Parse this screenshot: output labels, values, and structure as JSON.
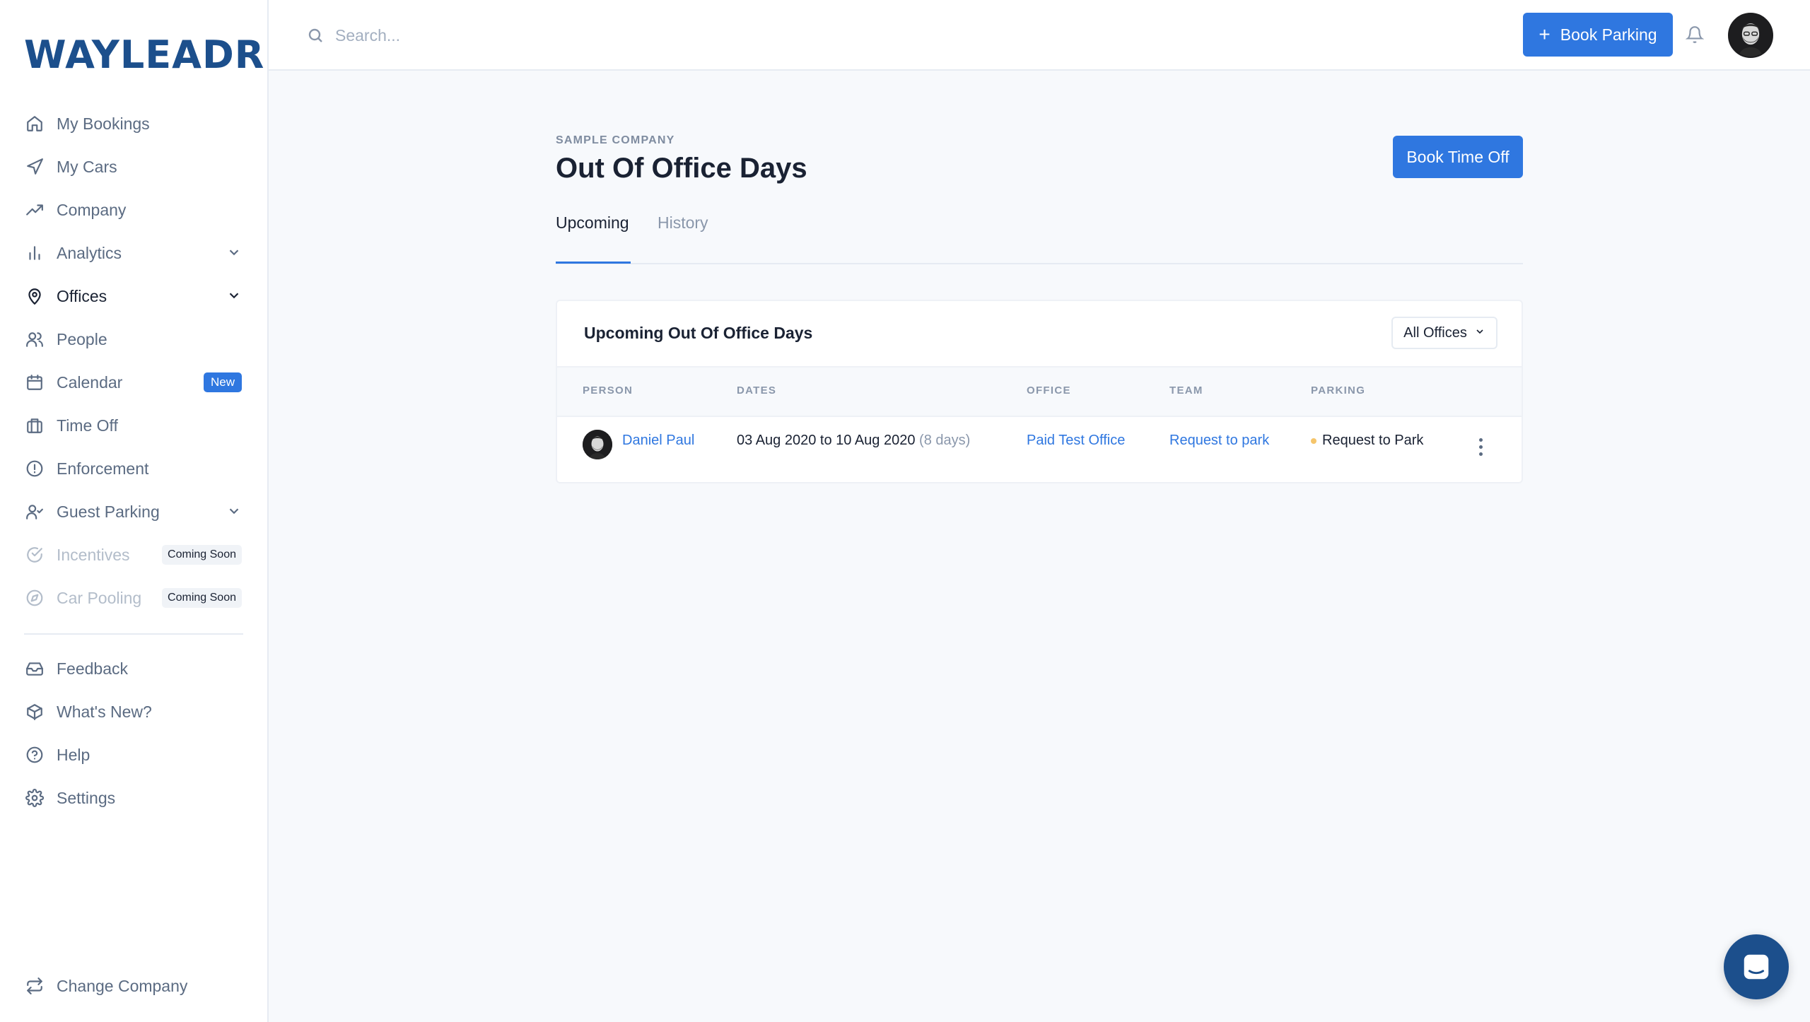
{
  "brand": {
    "logo_text": "WAYLEADR",
    "color": "#1c4f8c"
  },
  "accent_color": "#2f77e0",
  "sidebar": {
    "items": [
      {
        "label": "My Bookings",
        "icon": "home-icon"
      },
      {
        "label": "My Cars",
        "icon": "navigation-icon"
      },
      {
        "label": "Company",
        "icon": "trending-up-icon"
      },
      {
        "label": "Analytics",
        "icon": "bar-chart-icon"
      },
      {
        "label": "Offices",
        "icon": "map-pin-icon"
      },
      {
        "label": "People",
        "icon": "users-icon"
      },
      {
        "label": "Calendar",
        "icon": "calendar-icon",
        "badge": "New"
      },
      {
        "label": "Time Off",
        "icon": "briefcase-icon"
      },
      {
        "label": "Enforcement",
        "icon": "alert-circle-icon"
      },
      {
        "label": "Guest Parking",
        "icon": "user-check-icon"
      },
      {
        "label": "Incentives",
        "icon": "check-circle-icon",
        "badge": "Coming Soon"
      },
      {
        "label": "Car Pooling",
        "icon": "compass-icon",
        "badge": "Coming Soon"
      }
    ],
    "footer_items": [
      {
        "label": "Feedback",
        "icon": "inbox-icon"
      },
      {
        "label": "What's New?",
        "icon": "package-icon"
      },
      {
        "label": "Help",
        "icon": "help-circle-icon"
      },
      {
        "label": "Settings",
        "icon": "settings-icon"
      }
    ],
    "change_company": "Change Company"
  },
  "topbar": {
    "search_placeholder": "Search...",
    "book_parking_label": "Book Parking",
    "book_parking_icon": "+"
  },
  "page": {
    "eyebrow": "SAMPLE COMPANY",
    "title": "Out Of Office Days",
    "book_time_off_label": "Book Time Off",
    "tabs": [
      {
        "label": "Upcoming",
        "active": true
      },
      {
        "label": "History",
        "active": false
      }
    ]
  },
  "card": {
    "title": "Upcoming Out Of Office Days",
    "filter_label": "All Offices",
    "columns": [
      "PERSON",
      "DATES",
      "OFFICE",
      "TEAM",
      "PARKING"
    ],
    "rows": [
      {
        "person": "Daniel Paul",
        "dates": "03 Aug 2020 to 10 Aug 2020",
        "duration": "(8 days)",
        "office": "Paid Test Office",
        "team": "Request to park",
        "parking": "Request to Park",
        "status_color": "#f5c56b"
      }
    ]
  }
}
